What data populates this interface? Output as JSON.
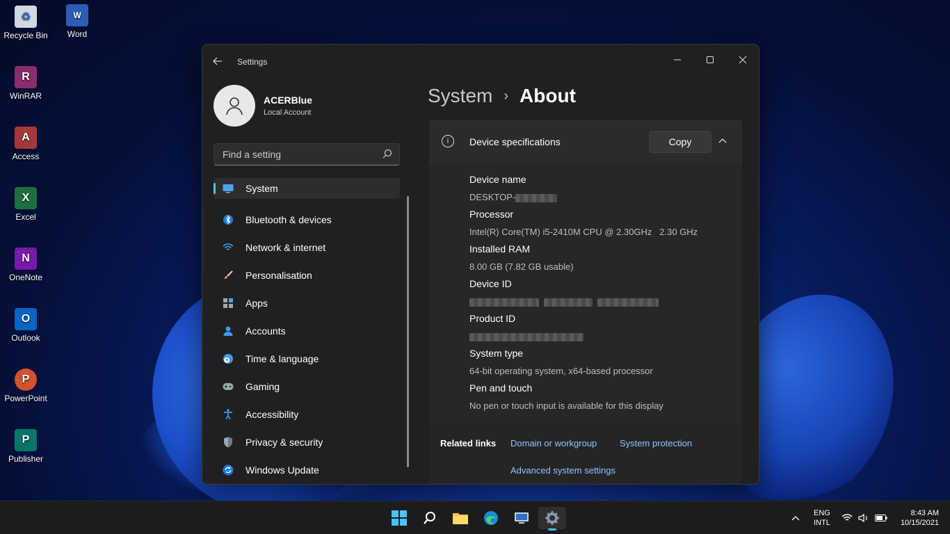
{
  "desktop": {
    "icons": [
      {
        "label": "Recycle Bin"
      },
      {
        "label": "Word"
      },
      {
        "label": "WinRAR"
      },
      {
        "label": "Access"
      },
      {
        "label": "Excel"
      },
      {
        "label": "OneNote"
      },
      {
        "label": "Outlook"
      },
      {
        "label": "PowerPoint"
      },
      {
        "label": "Publisher"
      }
    ]
  },
  "window": {
    "title": "Settings",
    "profile": {
      "name": "ACERBlue",
      "subtitle": "Local Account"
    },
    "search": {
      "placeholder": "Find a setting"
    },
    "nav": [
      {
        "label": "System",
        "icon": "monitor-icon",
        "active": true
      },
      {
        "label": "Bluetooth & devices",
        "icon": "bluetooth-icon"
      },
      {
        "label": "Network & internet",
        "icon": "wifi-icon"
      },
      {
        "label": "Personalisation",
        "icon": "brush-icon"
      },
      {
        "label": "Apps",
        "icon": "apps-icon"
      },
      {
        "label": "Accounts",
        "icon": "person-icon"
      },
      {
        "label": "Time & language",
        "icon": "globe-clock-icon"
      },
      {
        "label": "Gaming",
        "icon": "gamepad-icon"
      },
      {
        "label": "Accessibility",
        "icon": "accessibility-icon"
      },
      {
        "label": "Privacy & security",
        "icon": "shield-icon"
      },
      {
        "label": "Windows Update",
        "icon": "update-icon"
      }
    ],
    "breadcrumb": {
      "parent": "System",
      "separator": "›",
      "current": "About"
    },
    "device_specs": {
      "title": "Device specifications",
      "copy_label": "Copy",
      "items": [
        {
          "label": "Device name",
          "value": "DESKTOP-"
        },
        {
          "label": "Processor",
          "value": "Intel(R) Core(TM) i5-2410M CPU @ 2.30GHz   2.30 GHz"
        },
        {
          "label": "Installed RAM",
          "value": "8.00 GB (7.82 GB usable)"
        },
        {
          "label": "Device ID",
          "value": ""
        },
        {
          "label": "Product ID",
          "value": ""
        },
        {
          "label": "System type",
          "value": "64-bit operating system, x64-based processor"
        },
        {
          "label": "Pen and touch",
          "value": "No pen or touch input is available for this display"
        }
      ]
    },
    "related_links": {
      "title": "Related links",
      "links": [
        "Domain or workgroup",
        "System protection",
        "Advanced system settings"
      ]
    }
  },
  "taskbar": {
    "lang_line1": "ENG",
    "lang_line2": "INTL",
    "time": "8:43 AM",
    "date": "10/15/2021"
  },
  "colors": {
    "accent": "#4cc2ff",
    "link": "#8fc5ff",
    "window_bg": "#202020"
  }
}
